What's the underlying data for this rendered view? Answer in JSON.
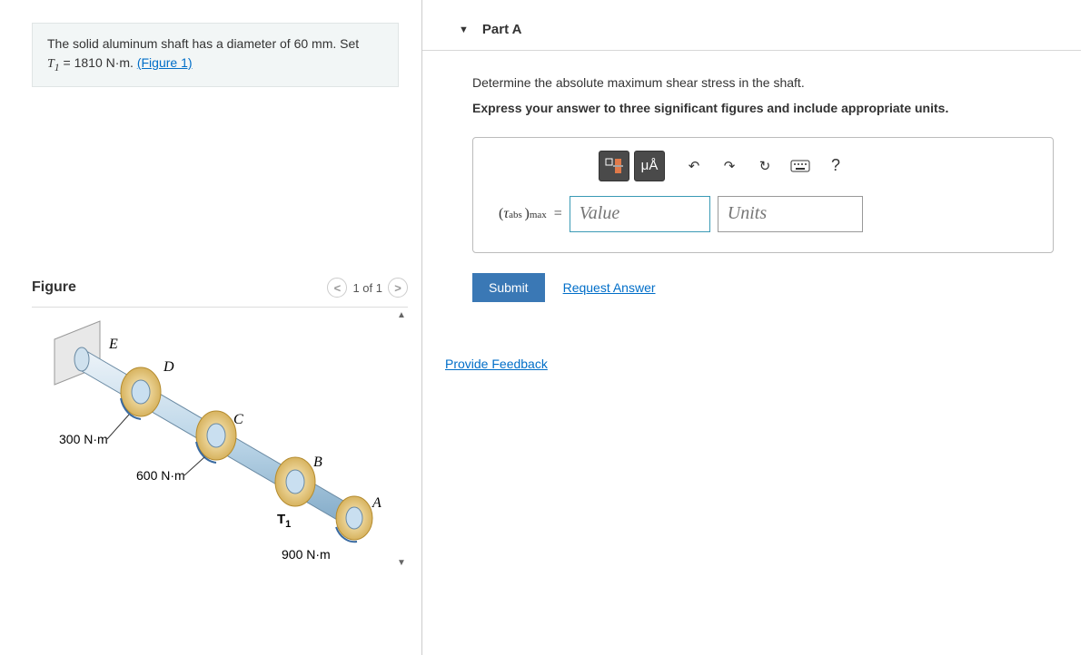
{
  "problem": {
    "line1_pre": "The solid aluminum shaft has a diameter of ",
    "diameter": "60 mm",
    "line1_post": ". Set ",
    "var": "T",
    "sub": "1",
    "eq": " = 1810 N·m. ",
    "figlink": "(Figure 1)"
  },
  "figure": {
    "title": "Figure",
    "pager": "1 of 1",
    "labels": {
      "E": "E",
      "D": "D",
      "C": "C",
      "B": "B",
      "A": "A",
      "T1": "T",
      "t300": "300 N·m",
      "t600": "600 N·m",
      "t900": "900 N·m"
    }
  },
  "part": {
    "title": "Part A",
    "prompt": "Determine the absolute maximum shear stress in the shaft.",
    "instruction": "Express your answer to three significant figures and include appropriate units."
  },
  "toolbar": {
    "units_symbol": "μÅ",
    "help": "?"
  },
  "answer": {
    "lhs_tau": "τ",
    "lhs_sub": "abs",
    "lhs_paren": ")",
    "lhs_max": "max",
    "equals": " = ",
    "value_placeholder": "Value",
    "units_placeholder": "Units"
  },
  "actions": {
    "submit": "Submit",
    "request": "Request Answer",
    "feedback": "Provide Feedback"
  }
}
